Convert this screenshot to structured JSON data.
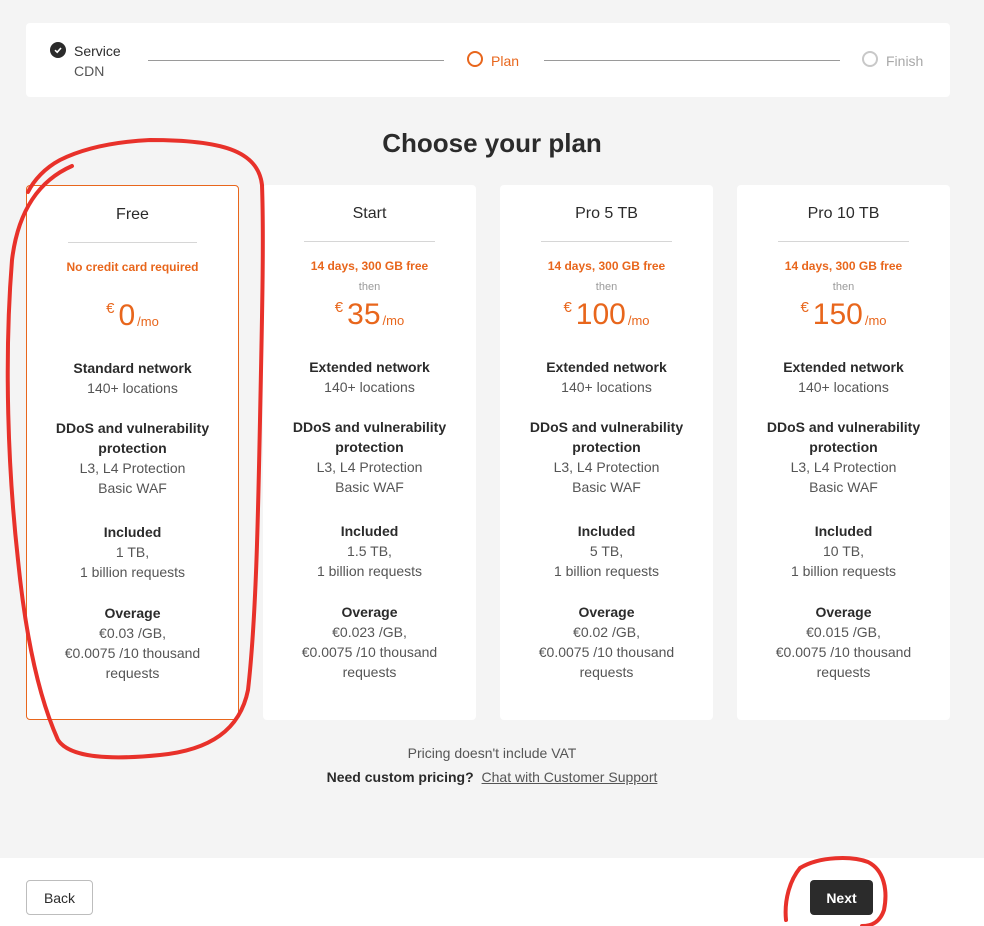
{
  "stepper": {
    "steps": [
      {
        "label": "Service",
        "sub": "CDN",
        "state": "done"
      },
      {
        "label": "Plan",
        "state": "active"
      },
      {
        "label": "Finish",
        "state": "pending"
      }
    ]
  },
  "title": "Choose your plan",
  "plans": [
    {
      "name": "Free",
      "selected": true,
      "note": "No credit card required",
      "then": "",
      "currency": "€",
      "price": "0",
      "per": "/mo",
      "network": "Standard network",
      "locations": "140+ locations",
      "ddos_title": "DDoS and vulnerability protection",
      "ddos_l1": "L3, L4 Protection",
      "ddos_l2": "Basic WAF",
      "included_title": "Included",
      "included_l1": "1 TB,",
      "included_l2": "1 billion requests",
      "overage_title": "Overage",
      "overage_l1": "€0.03 /GB,",
      "overage_l2": "€0.0075 /10 thousand requests"
    },
    {
      "name": "Start",
      "selected": false,
      "note": "14 days, 300 GB free",
      "then": "then",
      "currency": "€",
      "price": "35",
      "per": "/mo",
      "network": "Extended network",
      "locations": "140+ locations",
      "ddos_title": "DDoS and vulnerability protection",
      "ddos_l1": "L3, L4 Protection",
      "ddos_l2": "Basic WAF",
      "included_title": "Included",
      "included_l1": "1.5 TB,",
      "included_l2": "1 billion requests",
      "overage_title": "Overage",
      "overage_l1": "€0.023 /GB,",
      "overage_l2": "€0.0075 /10 thousand requests"
    },
    {
      "name": "Pro 5 TB",
      "selected": false,
      "note": "14 days, 300 GB free",
      "then": "then",
      "currency": "€",
      "price": "100",
      "per": "/mo",
      "network": "Extended network",
      "locations": "140+ locations",
      "ddos_title": "DDoS and vulnerability protection",
      "ddos_l1": "L3, L4 Protection",
      "ddos_l2": "Basic WAF",
      "included_title": "Included",
      "included_l1": "5 TB,",
      "included_l2": "1 billion requests",
      "overage_title": "Overage",
      "overage_l1": "€0.02 /GB,",
      "overage_l2": "€0.0075 /10 thousand requests"
    },
    {
      "name": "Pro 10 TB",
      "selected": false,
      "note": "14 days, 300 GB free",
      "then": "then",
      "currency": "€",
      "price": "150",
      "per": "/mo",
      "network": "Extended network",
      "locations": "140+ locations",
      "ddos_title": "DDoS and vulnerability protection",
      "ddos_l1": "L3, L4 Protection",
      "ddos_l2": "Basic WAF",
      "included_title": "Included",
      "included_l1": "10 TB,",
      "included_l2": "1 billion requests",
      "overage_title": "Overage",
      "overage_l1": "€0.015 /GB,",
      "overage_l2": "€0.0075 /10 thousand requests"
    }
  ],
  "footer": {
    "vat_note": "Pricing doesn't include VAT",
    "custom_question": "Need custom pricing?",
    "custom_link": "Chat with Customer Support"
  },
  "actions": {
    "back": "Back",
    "next": "Next"
  },
  "colors": {
    "accent": "#e8661c",
    "dark": "#2b2b2b",
    "annotation": "#e8312a"
  }
}
